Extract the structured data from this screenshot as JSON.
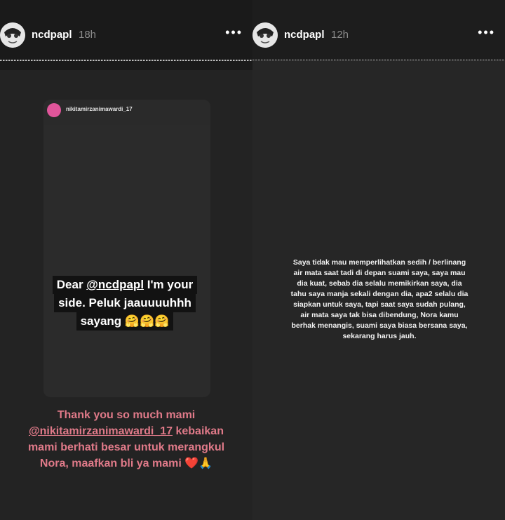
{
  "story_left": {
    "username": "ncdpapl",
    "time": "18h",
    "more_label": "•••",
    "shared_post": {
      "username": "nikitamirzanimawardi_17",
      "quote_lines": [
        {
          "pre": "Dear ",
          "mention": "@ncdpapl",
          "post": " I'm your"
        },
        {
          "text": "side. Peluk jaauuuuhhh"
        },
        {
          "text": "sayang 🤗🤗🤗"
        }
      ]
    },
    "caption_lines": [
      {
        "text": "Thank you so much mami"
      },
      {
        "mention": "@nikitamirzanimawardi_17",
        "post": " kebaikan"
      },
      {
        "text": "mami berhati besar untuk merangkul"
      },
      {
        "text": "Nora, maafkan bli ya mami ❤️🙏"
      }
    ]
  },
  "story_right": {
    "username": "ncdpapl",
    "time": "12h",
    "more_label": "•••",
    "text_lines": [
      "Saya tidak mau memperlihatkan sedih / berlinang",
      "air mata saat tadi di depan suami saya, saya mau",
      "dia kuat, sebab dia selalu memikirkan saya, dia",
      "tahu saya manja sekali dengan dia, apa2 selalu dia",
      "siapkan untuk saya, tapi saat saya sudah pulang,",
      "air mata saya tak bisa dibendung, Nora kamu",
      "berhak menangis, suami saya biasa bersana saya,",
      "sekarang harus jauh."
    ]
  }
}
